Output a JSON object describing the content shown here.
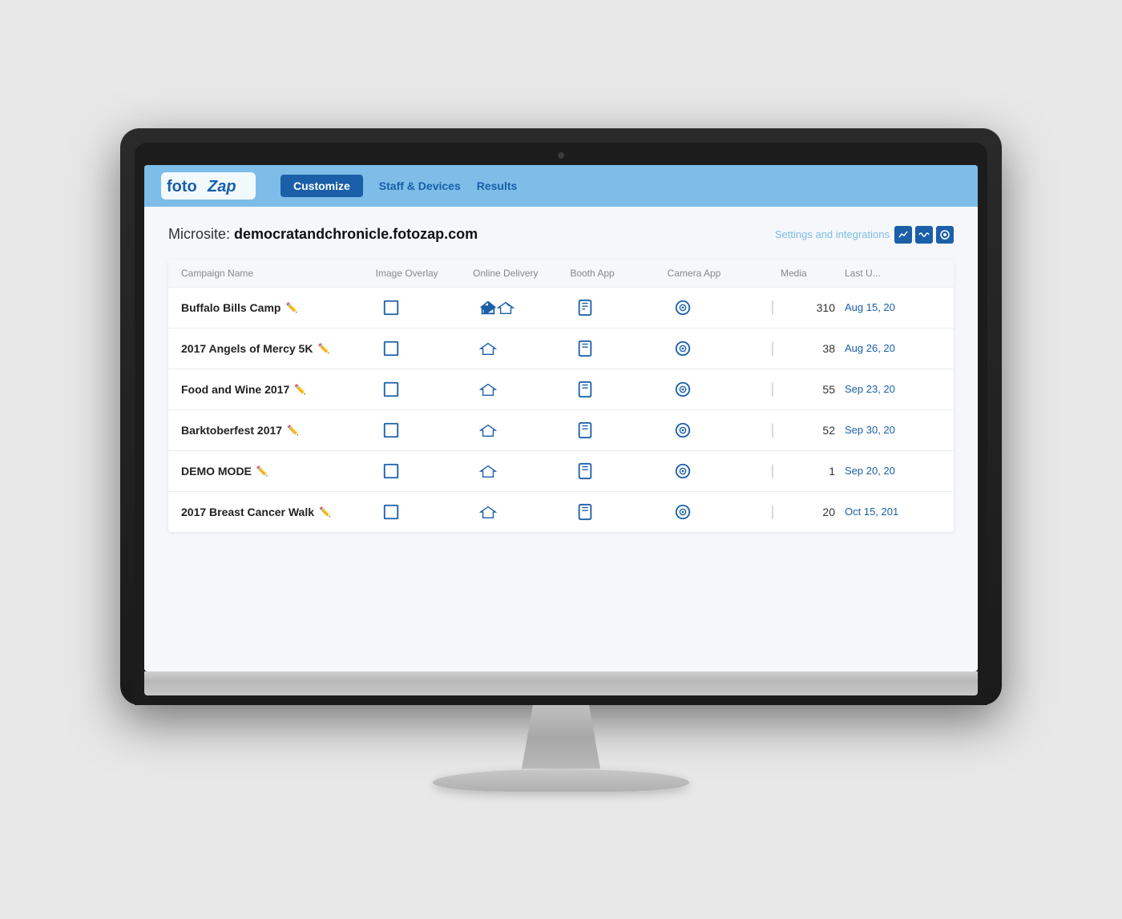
{
  "monitor": {
    "camera_label": "camera"
  },
  "header": {
    "logo": "fotozap",
    "logo_foto": "foto",
    "logo_zap": "Zap",
    "nav_items": [
      {
        "label": "Customize",
        "active": true
      },
      {
        "label": "Staff & Devices",
        "active": false
      },
      {
        "label": "Results",
        "active": false
      }
    ]
  },
  "main": {
    "microsite_label": "Microsite:",
    "microsite_url": "democratandchronicle.fotozap.com",
    "settings_label": "Settings and integrations",
    "table": {
      "columns": [
        "Campaign Name",
        "Image Overlay",
        "Online Delivery",
        "Booth App",
        "Camera App",
        "|",
        "Media",
        "Last U..."
      ],
      "rows": [
        {
          "name": "Buffalo Bills Camp",
          "media": "310",
          "date": "Aug 15, 20"
        },
        {
          "name": "2017 Angels of Mercy 5K",
          "media": "38",
          "date": "Aug 26, 20"
        },
        {
          "name": "Food and Wine 2017",
          "media": "55",
          "date": "Sep 23, 20"
        },
        {
          "name": "Barktoberfest 2017",
          "media": "52",
          "date": "Sep 30, 20"
        },
        {
          "name": "DEMO MODE",
          "media": "1",
          "date": "Sep 20, 20"
        },
        {
          "name": "2017 Breast Cancer Walk",
          "media": "20",
          "date": "Oct 15, 201"
        }
      ]
    }
  }
}
